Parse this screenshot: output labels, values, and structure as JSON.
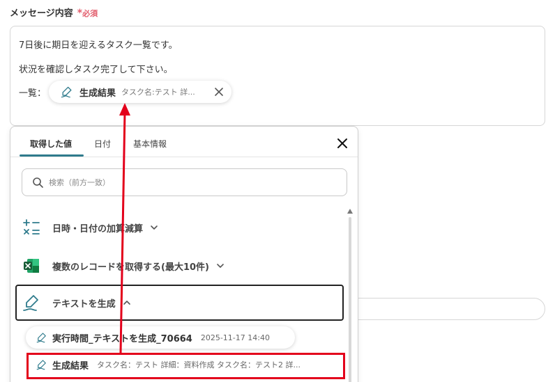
{
  "field": {
    "label": "メッセージ内容",
    "required_star": "*",
    "required_text": "必須"
  },
  "message": {
    "line1": "7日後に期日を迎えるタスク一覧です。",
    "line2": "状況を確認しタスク完了して下さい。",
    "line3_prefix": "一覧：",
    "chip": {
      "title": "生成結果",
      "desc": "タスク名:テスト 詳..."
    }
  },
  "panel": {
    "tabs": [
      {
        "label": "取得した値",
        "active": true
      },
      {
        "label": "日付",
        "active": false
      },
      {
        "label": "基本情報",
        "active": false
      }
    ],
    "search_placeholder": "検索（前方一致）",
    "items": [
      {
        "label": "日時・日付の加算減算",
        "icon": "calculator-icon",
        "expanded": false
      },
      {
        "label": "複数のレコードを取得する(最大10件)",
        "icon": "excel-icon",
        "expanded": false
      },
      {
        "label": "テキストを生成",
        "icon": "pen-icon",
        "expanded": true
      }
    ],
    "sub_items": [
      {
        "title": "実行時間_テキストを生成_70664",
        "desc": "2025-11-17 14:40"
      },
      {
        "title": "生成結果",
        "desc": "タスク名：テスト 詳細：資料作成 タスク名：テスト2 詳..."
      }
    ]
  },
  "colors": {
    "accent": "#2f7b8c",
    "required": "#e25d6c",
    "highlight": "#e3001b",
    "excel_green": "#1d7a45"
  }
}
